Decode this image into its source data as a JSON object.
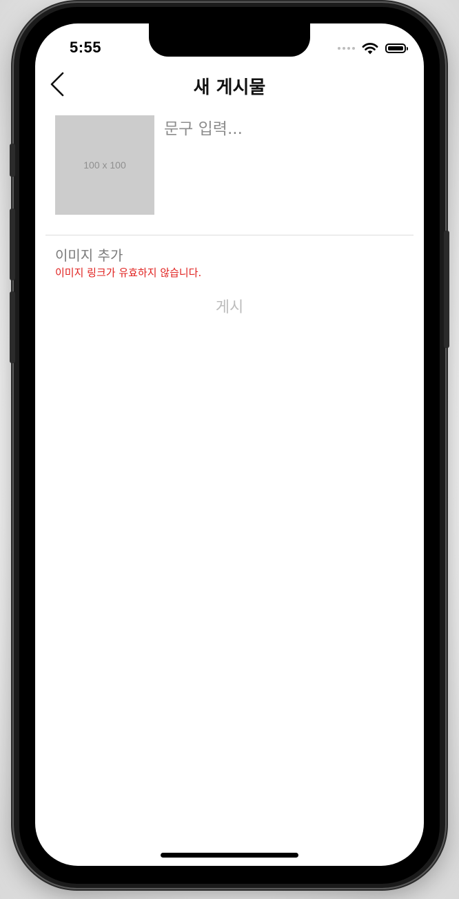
{
  "status_bar": {
    "time": "5:55",
    "signal_icon": "cellular-signal-dots",
    "wifi_icon": "wifi-icon",
    "battery_icon": "battery-full-icon",
    "battery_level_fraction": 1.0
  },
  "nav": {
    "back_icon": "chevron-left-icon",
    "title": "새 게시물"
  },
  "compose": {
    "thumbnail_label": "100 x 100",
    "caption_placeholder": "문구 입력...",
    "caption_value": ""
  },
  "image": {
    "add_label": "이미지 추가",
    "error_message": "이미지 링크가 유효하지 않습니다."
  },
  "actions": {
    "post_label": "게시",
    "post_enabled": false
  },
  "colors": {
    "error": "#e0201e",
    "disabled_text": "#bcbcbc",
    "placeholder": "#8c8c8c",
    "thumbnail_bg": "#cccccc"
  }
}
